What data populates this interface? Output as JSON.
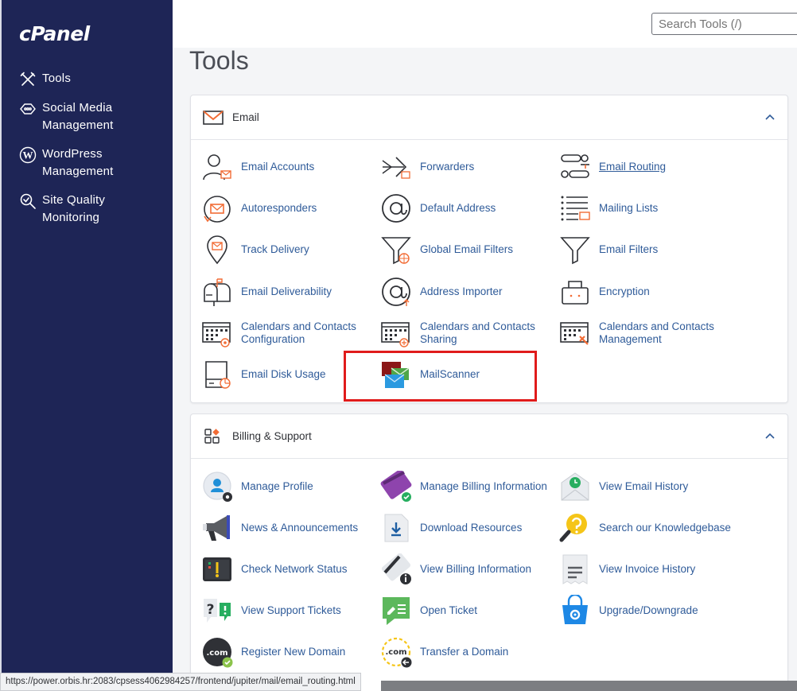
{
  "brand": {
    "logo": "cPanel"
  },
  "sidebar": {
    "items": [
      {
        "label": "Tools",
        "icon": "tools-icon"
      },
      {
        "label": "Social Media\nManagement",
        "icon": "social-media-icon"
      },
      {
        "label": "WordPress\nManagement",
        "icon": "wordpress-icon"
      },
      {
        "label": "Site Quality\nMonitoring",
        "icon": "site-quality-icon"
      }
    ]
  },
  "search": {
    "placeholder": "Search Tools (/)"
  },
  "page": {
    "title": "Tools"
  },
  "email_section": {
    "title": "Email",
    "items": [
      {
        "label": "Email Accounts",
        "icon": "email-accounts-icon"
      },
      {
        "label": "Forwarders",
        "icon": "forwarders-icon"
      },
      {
        "label": "Email Routing",
        "icon": "email-routing-icon"
      },
      {
        "label": "Autoresponders",
        "icon": "autoresponders-icon"
      },
      {
        "label": "Default Address",
        "icon": "default-address-icon"
      },
      {
        "label": "Mailing Lists",
        "icon": "mailing-lists-icon"
      },
      {
        "label": "Track Delivery",
        "icon": "track-delivery-icon"
      },
      {
        "label": "Global Email Filters",
        "icon": "global-email-filters-icon"
      },
      {
        "label": "Email Filters",
        "icon": "email-filters-icon"
      },
      {
        "label": "Email Deliverability",
        "icon": "email-deliverability-icon"
      },
      {
        "label": "Address Importer",
        "icon": "address-importer-icon"
      },
      {
        "label": "Encryption",
        "icon": "encryption-icon"
      },
      {
        "label": "Calendars and Contacts\nConfiguration",
        "icon": "calendars-configuration-icon"
      },
      {
        "label": "Calendars and Contacts\nSharing",
        "icon": "calendars-sharing-icon"
      },
      {
        "label": "Calendars and Contacts\nManagement",
        "icon": "calendars-management-icon"
      },
      {
        "label": "Email Disk Usage",
        "icon": "email-disk-usage-icon"
      },
      {
        "label": "MailScanner",
        "icon": "mailscanner-icon"
      }
    ]
  },
  "billing_section": {
    "title": "Billing & Support",
    "items": [
      {
        "label": "Manage Profile",
        "icon": "manage-profile-icon"
      },
      {
        "label": "Manage Billing Information",
        "icon": "manage-billing-icon"
      },
      {
        "label": "View Email History",
        "icon": "email-history-icon"
      },
      {
        "label": "News & Announcements",
        "icon": "megaphone-icon"
      },
      {
        "label": "Download Resources",
        "icon": "download-icon"
      },
      {
        "label": "Search our Knowledgebase",
        "icon": "knowledgebase-icon"
      },
      {
        "label": "Check Network Status",
        "icon": "network-status-icon"
      },
      {
        "label": "View Billing Information",
        "icon": "billing-info-icon"
      },
      {
        "label": "View Invoice History",
        "icon": "invoice-history-icon"
      },
      {
        "label": "View Support Tickets",
        "icon": "support-tickets-icon"
      },
      {
        "label": "Open Ticket",
        "icon": "open-ticket-icon"
      },
      {
        "label": "Upgrade/Downgrade",
        "icon": "upgrade-icon"
      },
      {
        "label": "Register New Domain",
        "icon": "register-domain-icon"
      },
      {
        "label": "Transfer a Domain",
        "icon": "transfer-domain-icon"
      }
    ]
  },
  "status_url": "https://power.orbis.hr:2083/cpsess4062984257/frontend/jupiter/mail/email_routing.html",
  "colors": {
    "sidebar": "#1e2556",
    "link": "#2f5b99",
    "highlight": "#e01b1b",
    "accent_orange": "#f26c35"
  }
}
